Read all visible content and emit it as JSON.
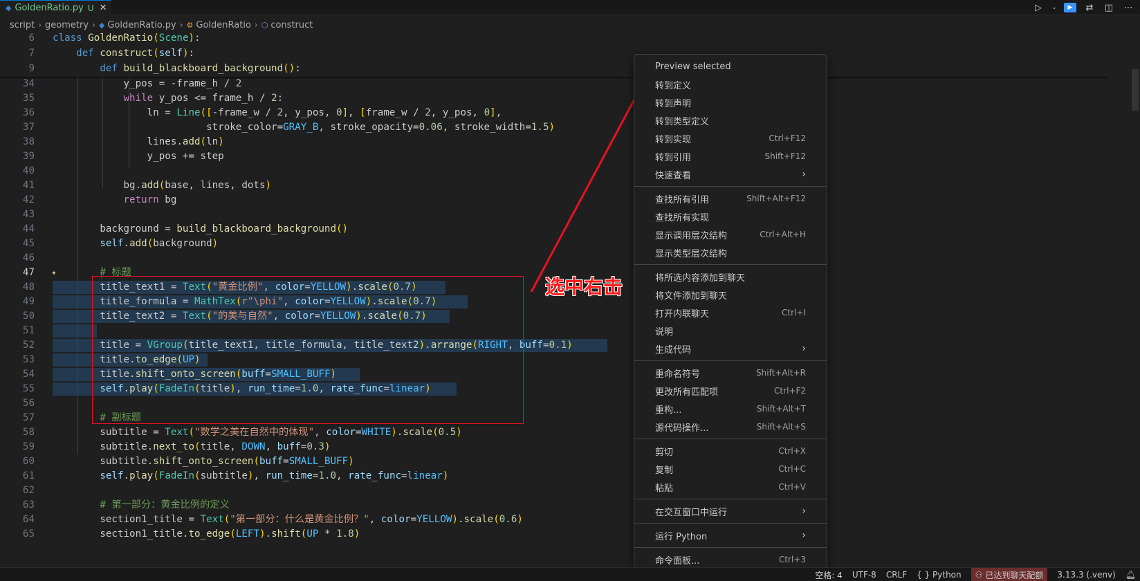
{
  "tab": {
    "icon": "python-file-icon",
    "name": "GoldenRatio.py",
    "modified": "U",
    "close": "✕"
  },
  "breadcrumb": [
    "script",
    "geometry",
    "GoldenRatio.py",
    "GoldenRatio",
    "construct"
  ],
  "sticky": [
    {
      "num": "6",
      "code": "class GoldenRatio(Scene):"
    },
    {
      "num": "7",
      "code": "    def construct(self):"
    },
    {
      "num": "9",
      "code": "        def build_blackboard_background():"
    }
  ],
  "lines": [
    {
      "num": "34",
      "code": "            y_pos = -frame_h / 2"
    },
    {
      "num": "35",
      "code": "            while y_pos <= frame_h / 2:"
    },
    {
      "num": "36",
      "code": "                ln = Line([-frame_w / 2, y_pos, 0], [frame_w / 2, y_pos, 0],"
    },
    {
      "num": "37",
      "code": "                          stroke_color=GRAY_B, stroke_opacity=0.06, stroke_width=1.5)"
    },
    {
      "num": "38",
      "code": "                lines.add(ln)"
    },
    {
      "num": "39",
      "code": "                y_pos += step"
    },
    {
      "num": "40",
      "code": ""
    },
    {
      "num": "41",
      "code": "            bg.add(base, lines, dots)"
    },
    {
      "num": "42",
      "code": "            return bg"
    },
    {
      "num": "43",
      "code": ""
    },
    {
      "num": "44",
      "code": "        background = build_blackboard_background()"
    },
    {
      "num": "45",
      "code": "        self.add(background)"
    },
    {
      "num": "46",
      "code": ""
    },
    {
      "num": "47",
      "code": "        # 标题"
    },
    {
      "num": "48",
      "code": "        title_text1 = Text(\"黄金比例\", color=YELLOW).scale(0.7)"
    },
    {
      "num": "49",
      "code": "        title_formula = MathTex(r\"\\phi\", color=YELLOW).scale(0.7)"
    },
    {
      "num": "50",
      "code": "        title_text2 = Text(\"的美与自然\", color=YELLOW).scale(0.7)"
    },
    {
      "num": "51",
      "code": ""
    },
    {
      "num": "52",
      "code": "        title = VGroup(title_text1, title_formula, title_text2).arrange(RIGHT, buff=0.1)"
    },
    {
      "num": "53",
      "code": "        title.to_edge(UP)"
    },
    {
      "num": "54",
      "code": "        title.shift_onto_screen(buff=SMALL_BUFF)"
    },
    {
      "num": "55",
      "code": "        self.play(FadeIn(title), run_time=1.0, rate_func=linear)"
    },
    {
      "num": "56",
      "code": ""
    },
    {
      "num": "57",
      "code": "        # 副标题"
    },
    {
      "num": "58",
      "code": "        subtitle = Text(\"数学之美在自然中的体现\", color=WHITE).scale(0.5)"
    },
    {
      "num": "59",
      "code": "        subtitle.next_to(title, DOWN, buff=0.3)"
    },
    {
      "num": "60",
      "code": "        subtitle.shift_onto_screen(buff=SMALL_BUFF)"
    },
    {
      "num": "61",
      "code": "        self.play(FadeIn(subtitle), run_time=1.0, rate_func=linear)"
    },
    {
      "num": "62",
      "code": ""
    },
    {
      "num": "63",
      "code": "        # 第一部分：黄金比例的定义"
    },
    {
      "num": "64",
      "code": "        section1_title = Text(\"第一部分：什么是黄金比例？\", color=YELLOW).scale(0.6)"
    },
    {
      "num": "65",
      "code": "        section1_title.to_edge(LEFT).shift(UP * 1.8)"
    }
  ],
  "annotation": "选中右击",
  "menu": [
    {
      "label": "Preview selected",
      "key": ""
    },
    {
      "label": "转到定义",
      "key": ""
    },
    {
      "label": "转到声明",
      "key": ""
    },
    {
      "label": "转到类型定义",
      "key": ""
    },
    {
      "label": "转到实现",
      "key": "Ctrl+F12"
    },
    {
      "label": "转到引用",
      "key": "Shift+F12"
    },
    {
      "label": "快速查看",
      "key": "",
      "submenu": "›"
    },
    {
      "sep": true
    },
    {
      "label": "查找所有引用",
      "key": "Shift+Alt+F12"
    },
    {
      "label": "查找所有实现",
      "key": ""
    },
    {
      "label": "显示调用层次结构",
      "key": "Ctrl+Alt+H"
    },
    {
      "label": "显示类型层次结构",
      "key": ""
    },
    {
      "sep": true
    },
    {
      "label": "将所选内容添加到聊天",
      "key": ""
    },
    {
      "label": "将文件添加到聊天",
      "key": ""
    },
    {
      "label": "打开内联聊天",
      "key": "Ctrl+I"
    },
    {
      "label": "说明",
      "key": ""
    },
    {
      "label": "生成代码",
      "key": "",
      "submenu": "›"
    },
    {
      "sep": true
    },
    {
      "label": "重命名符号",
      "key": "Shift+Alt+R"
    },
    {
      "label": "更改所有匹配项",
      "key": "Ctrl+F2"
    },
    {
      "label": "重构...",
      "key": "Shift+Alt+T"
    },
    {
      "label": "源代码操作...",
      "key": "Shift+Alt+S"
    },
    {
      "sep": true
    },
    {
      "label": "剪切",
      "key": "Ctrl+X"
    },
    {
      "label": "复制",
      "key": "Ctrl+C"
    },
    {
      "label": "粘贴",
      "key": "Ctrl+V"
    },
    {
      "sep": true
    },
    {
      "label": "在交互窗口中运行",
      "key": "",
      "submenu": "›"
    },
    {
      "sep": true
    },
    {
      "label": "运行 Python",
      "key": "",
      "submenu": "›"
    },
    {
      "sep": true
    },
    {
      "label": "命令面板...",
      "key": "Ctrl+3"
    }
  ],
  "status": {
    "spaces": "空格: 4",
    "encoding": "UTF-8",
    "eol": "CRLF",
    "language": "{ } Python",
    "chat_limit": "已达到聊天配额",
    "python_version": "3.13.3 (.venv)"
  },
  "colors": {
    "accent": "#0078d4",
    "annotation": "#e81123",
    "selection": "#264f78"
  }
}
